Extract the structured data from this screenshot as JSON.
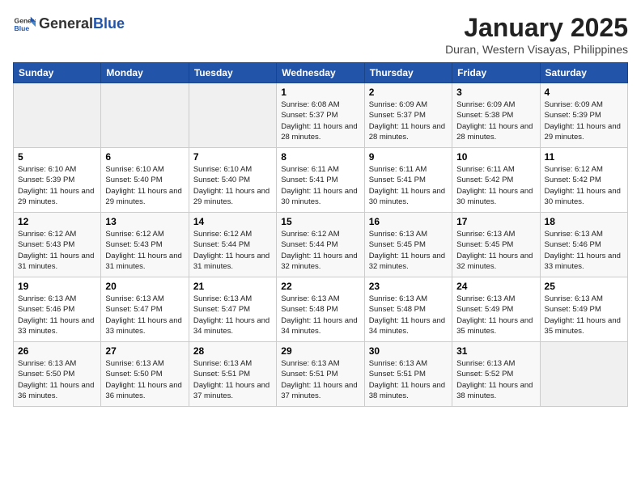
{
  "header": {
    "logo_general": "General",
    "logo_blue": "Blue",
    "title": "January 2025",
    "subtitle": "Duran, Western Visayas, Philippines"
  },
  "days_of_week": [
    "Sunday",
    "Monday",
    "Tuesday",
    "Wednesday",
    "Thursday",
    "Friday",
    "Saturday"
  ],
  "weeks": [
    [
      {
        "day": "",
        "empty": true
      },
      {
        "day": "",
        "empty": true
      },
      {
        "day": "",
        "empty": true
      },
      {
        "day": "1",
        "sunrise": "6:08 AM",
        "sunset": "5:37 PM",
        "daylight": "11 hours and 28 minutes."
      },
      {
        "day": "2",
        "sunrise": "6:09 AM",
        "sunset": "5:37 PM",
        "daylight": "11 hours and 28 minutes."
      },
      {
        "day": "3",
        "sunrise": "6:09 AM",
        "sunset": "5:38 PM",
        "daylight": "11 hours and 28 minutes."
      },
      {
        "day": "4",
        "sunrise": "6:09 AM",
        "sunset": "5:39 PM",
        "daylight": "11 hours and 29 minutes."
      }
    ],
    [
      {
        "day": "5",
        "sunrise": "6:10 AM",
        "sunset": "5:39 PM",
        "daylight": "11 hours and 29 minutes."
      },
      {
        "day": "6",
        "sunrise": "6:10 AM",
        "sunset": "5:40 PM",
        "daylight": "11 hours and 29 minutes."
      },
      {
        "day": "7",
        "sunrise": "6:10 AM",
        "sunset": "5:40 PM",
        "daylight": "11 hours and 29 minutes."
      },
      {
        "day": "8",
        "sunrise": "6:11 AM",
        "sunset": "5:41 PM",
        "daylight": "11 hours and 30 minutes."
      },
      {
        "day": "9",
        "sunrise": "6:11 AM",
        "sunset": "5:41 PM",
        "daylight": "11 hours and 30 minutes."
      },
      {
        "day": "10",
        "sunrise": "6:11 AM",
        "sunset": "5:42 PM",
        "daylight": "11 hours and 30 minutes."
      },
      {
        "day": "11",
        "sunrise": "6:12 AM",
        "sunset": "5:42 PM",
        "daylight": "11 hours and 30 minutes."
      }
    ],
    [
      {
        "day": "12",
        "sunrise": "6:12 AM",
        "sunset": "5:43 PM",
        "daylight": "11 hours and 31 minutes."
      },
      {
        "day": "13",
        "sunrise": "6:12 AM",
        "sunset": "5:43 PM",
        "daylight": "11 hours and 31 minutes."
      },
      {
        "day": "14",
        "sunrise": "6:12 AM",
        "sunset": "5:44 PM",
        "daylight": "11 hours and 31 minutes."
      },
      {
        "day": "15",
        "sunrise": "6:12 AM",
        "sunset": "5:44 PM",
        "daylight": "11 hours and 32 minutes."
      },
      {
        "day": "16",
        "sunrise": "6:13 AM",
        "sunset": "5:45 PM",
        "daylight": "11 hours and 32 minutes."
      },
      {
        "day": "17",
        "sunrise": "6:13 AM",
        "sunset": "5:45 PM",
        "daylight": "11 hours and 32 minutes."
      },
      {
        "day": "18",
        "sunrise": "6:13 AM",
        "sunset": "5:46 PM",
        "daylight": "11 hours and 33 minutes."
      }
    ],
    [
      {
        "day": "19",
        "sunrise": "6:13 AM",
        "sunset": "5:46 PM",
        "daylight": "11 hours and 33 minutes."
      },
      {
        "day": "20",
        "sunrise": "6:13 AM",
        "sunset": "5:47 PM",
        "daylight": "11 hours and 33 minutes."
      },
      {
        "day": "21",
        "sunrise": "6:13 AM",
        "sunset": "5:47 PM",
        "daylight": "11 hours and 34 minutes."
      },
      {
        "day": "22",
        "sunrise": "6:13 AM",
        "sunset": "5:48 PM",
        "daylight": "11 hours and 34 minutes."
      },
      {
        "day": "23",
        "sunrise": "6:13 AM",
        "sunset": "5:48 PM",
        "daylight": "11 hours and 34 minutes."
      },
      {
        "day": "24",
        "sunrise": "6:13 AM",
        "sunset": "5:49 PM",
        "daylight": "11 hours and 35 minutes."
      },
      {
        "day": "25",
        "sunrise": "6:13 AM",
        "sunset": "5:49 PM",
        "daylight": "11 hours and 35 minutes."
      }
    ],
    [
      {
        "day": "26",
        "sunrise": "6:13 AM",
        "sunset": "5:50 PM",
        "daylight": "11 hours and 36 minutes."
      },
      {
        "day": "27",
        "sunrise": "6:13 AM",
        "sunset": "5:50 PM",
        "daylight": "11 hours and 36 minutes."
      },
      {
        "day": "28",
        "sunrise": "6:13 AM",
        "sunset": "5:51 PM",
        "daylight": "11 hours and 37 minutes."
      },
      {
        "day": "29",
        "sunrise": "6:13 AM",
        "sunset": "5:51 PM",
        "daylight": "11 hours and 37 minutes."
      },
      {
        "day": "30",
        "sunrise": "6:13 AM",
        "sunset": "5:51 PM",
        "daylight": "11 hours and 38 minutes."
      },
      {
        "day": "31",
        "sunrise": "6:13 AM",
        "sunset": "5:52 PM",
        "daylight": "11 hours and 38 minutes."
      },
      {
        "day": "",
        "empty": true
      }
    ]
  ],
  "labels": {
    "sunrise": "Sunrise:",
    "sunset": "Sunset:",
    "daylight": "Daylight:"
  }
}
